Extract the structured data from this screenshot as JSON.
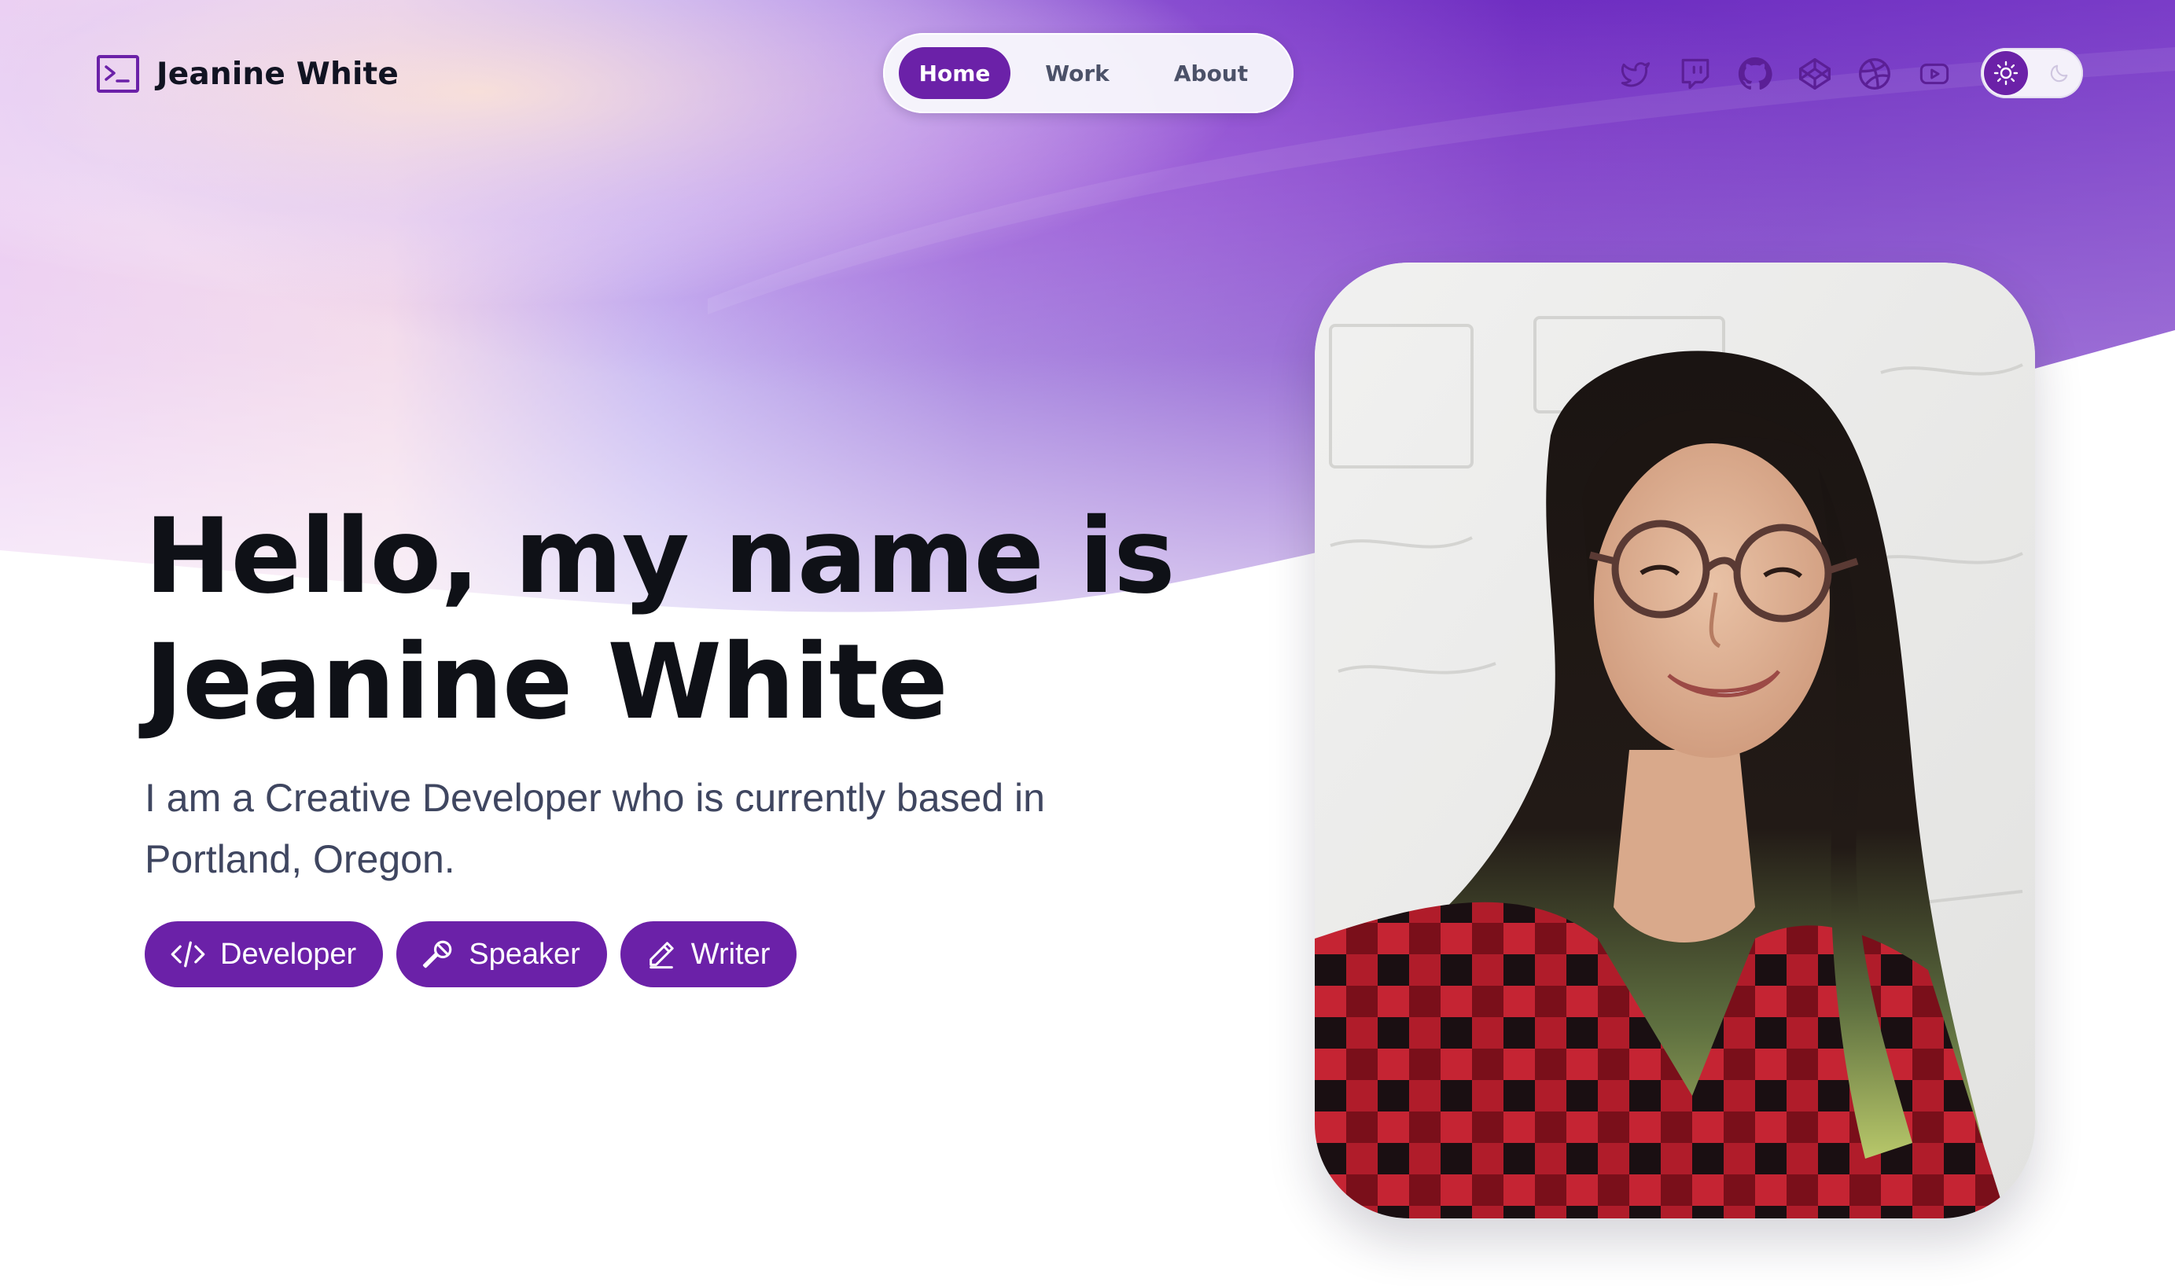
{
  "logo": {
    "name": "Jeanine White",
    "icon": "terminal-icon"
  },
  "nav": {
    "items": [
      {
        "label": "Home",
        "active": true
      },
      {
        "label": "Work",
        "active": false
      },
      {
        "label": "About",
        "active": false
      }
    ]
  },
  "socials": [
    {
      "icon": "twitter-icon"
    },
    {
      "icon": "twitch-icon"
    },
    {
      "icon": "github-icon"
    },
    {
      "icon": "codepen-icon"
    },
    {
      "icon": "dribbble-icon"
    },
    {
      "icon": "youtube-icon"
    }
  ],
  "theme_toggle": {
    "mode": "light",
    "icons": [
      "sun-icon",
      "moon-icon"
    ]
  },
  "hero": {
    "title_line1": "Hello, my name is",
    "title_line2": "Jeanine White",
    "subtitle": "I am a Creative Developer who is currently based in Portland, Oregon.",
    "chips": [
      {
        "label": "Developer",
        "icon": "code-icon"
      },
      {
        "label": "Speaker",
        "icon": "microphone-icon"
      },
      {
        "label": "Writer",
        "icon": "pencil-icon"
      }
    ]
  },
  "colors": {
    "accent": "#6b21a8",
    "title": "#0f1117",
    "subtitle": "#3f4660",
    "nav_text": "#4b5168"
  }
}
